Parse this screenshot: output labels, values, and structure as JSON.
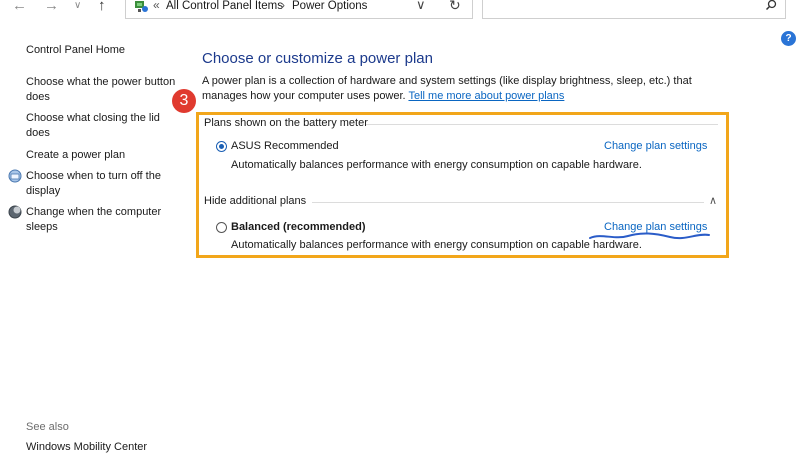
{
  "nav": {
    "back_icon": "arrow-left-icon",
    "forward_icon": "arrow-right-icon",
    "recent_icon": "chevron-down-icon",
    "up_icon": "arrow-up-icon"
  },
  "address": {
    "overflow": "«",
    "crumb1": "All Control Panel Items",
    "separator": "›",
    "crumb2": "Power Options",
    "dropdown_icon": "chevron-down-icon",
    "refresh_icon": "refresh-icon"
  },
  "search": {
    "placeholder": "",
    "icon": "search-icon"
  },
  "help": {
    "label": "?"
  },
  "sidebar": {
    "home": "Control Panel Home",
    "items": [
      {
        "label": "Choose what the power button does"
      },
      {
        "label": "Choose what closing the lid does"
      },
      {
        "label": "Create a power plan"
      },
      {
        "label": "Choose when to turn off the display"
      },
      {
        "label": "Change when the computer sleeps"
      }
    ],
    "see_also": "See also",
    "mobility": "Windows Mobility Center"
  },
  "main": {
    "title": "Choose or customize a power plan",
    "intro": "A power plan is a collection of hardware and system settings (like display brightness, sleep, etc.) that manages how your computer uses power. ",
    "tell_more": "Tell me more about power plans",
    "step_badge": "3",
    "group1_label": "Plans shown on the battery meter",
    "group2_label": "Hide additional plans",
    "plans": [
      {
        "name": "ASUS Recommended",
        "selected": true,
        "description": "Automatically balances performance with energy consumption on capable hardware.",
        "change_link": "Change plan settings"
      },
      {
        "name": "Balanced (recommended)",
        "selected": false,
        "description": "Automatically balances performance with energy consumption on capable hardware.",
        "change_link": "Change plan settings"
      }
    ]
  },
  "colors": {
    "accent_title": "#1c3a8c",
    "link": "#0a66c2",
    "highlight_box": "#f2a61a",
    "badge": "#e03a2f",
    "squiggle": "#2a5cc8"
  }
}
